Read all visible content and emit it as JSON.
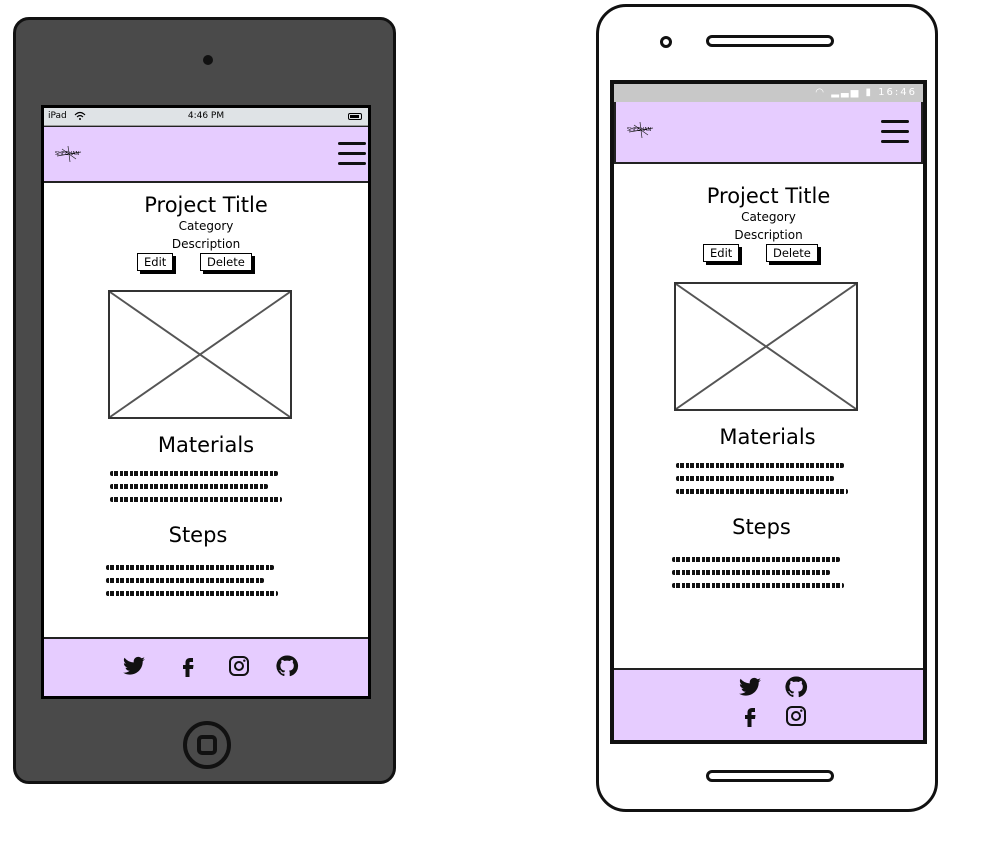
{
  "ipad": {
    "status": {
      "carrier": "iPad",
      "time": "4:46 PM"
    },
    "logo_text": "SHEEHAN",
    "project": {
      "title": "Project Title",
      "category": "Category",
      "description": "Description",
      "edit_label": "Edit",
      "delete_label": "Delete"
    },
    "materials_heading": "Materials",
    "steps_heading": "Steps"
  },
  "android": {
    "status": {
      "time": "16:46"
    },
    "logo_text": "SHEEHAN",
    "project": {
      "title": "Project Title",
      "category": "Category",
      "description": "Description",
      "edit_label": "Edit",
      "delete_label": "Delete"
    },
    "materials_heading": "Materials",
    "steps_heading": "Steps"
  },
  "footer_icons": [
    "twitter-icon",
    "facebook-icon",
    "instagram-icon",
    "github-icon"
  ],
  "colors": {
    "accent": "#e6ccff",
    "device_body": "#4a4a4a"
  }
}
